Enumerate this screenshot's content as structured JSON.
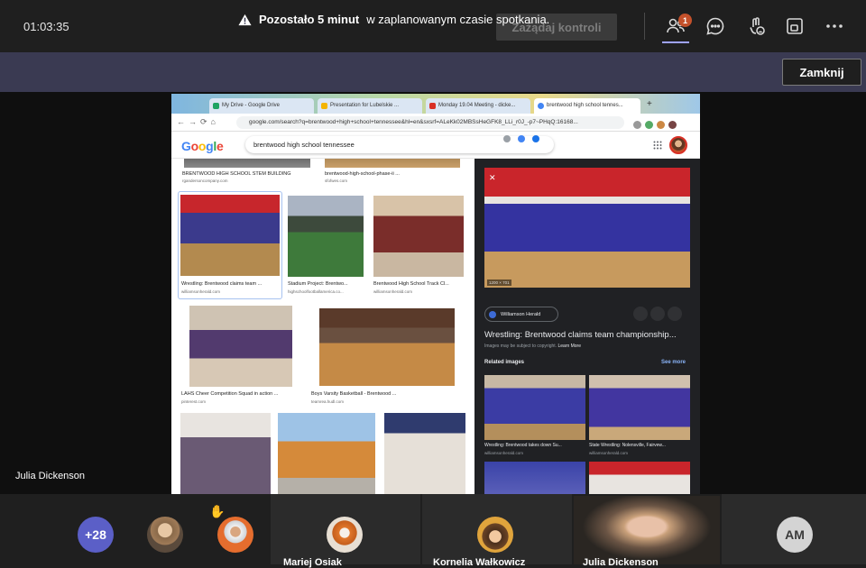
{
  "meeting": {
    "timer": "01:03:35",
    "request_control_label": "Zażądaj kontroli",
    "participants_badge": "1",
    "notice": {
      "strong": "Pozostało 5 minut",
      "rest": "w zaplanowanym czasie spotkania.",
      "close_label": "Zamknij"
    },
    "presenter_name": "Julia Dickenson",
    "participants": {
      "overflow_count": "+28",
      "names": [
        "Mariej Osiak",
        "Kornelia Wałkowicz",
        "Julia Dickenson"
      ],
      "initials": "AM"
    },
    "icons": [
      "people-icon",
      "chat-icon",
      "reactions-icon",
      "share-tray-icon",
      "more-icon"
    ]
  },
  "browser": {
    "tabs": [
      {
        "label": "My Drive - Google Drive",
        "color": "#1fa463"
      },
      {
        "label": "Presentation for Lubelskie ...",
        "color": "#f4b400"
      },
      {
        "label": "Monday 19.04 Meeting - dicke...",
        "color": "#d93025"
      },
      {
        "label": "brentwood high school tennes...",
        "color": "#4285f4"
      }
    ],
    "url": "google.com/search?q=brentwood+high+school+tennessee&hl=en&sxsrf=ALeKk02MBSsHeGFK8_LLi_r0J_-p7~PHqQ:16168...",
    "search_query": "brentwood high school tennessee"
  },
  "google": {
    "logo": "Google",
    "results": [
      {
        "title": "BRENTWOOD HIGH SCHOOL STEM BUILDING",
        "source": "rgandersoncompany.com"
      },
      {
        "title": "brentwood-high-school-phase-ii ...",
        "source": "sfofwes.com"
      },
      {
        "title": "Wrestling: Brentwood claims team ...",
        "source": "williamsonherald.com"
      },
      {
        "title": "Stadium Project: Brentwo...",
        "source": "highschoolfootballamerica.co..."
      },
      {
        "title": "Brentwood High School Track Cl...",
        "source": "williamsonherald.com"
      },
      {
        "title": "LAHS Cheer Competition Squad in action ...",
        "source": "pinterest.com"
      },
      {
        "title": "Boys Varsity Basketball - Brentwood ...",
        "source": "teamrea.hudl.com"
      }
    ],
    "preview": {
      "image_size": "1200 × 701",
      "source": "Williamson Herald",
      "title": "Wrestling: Brentwood claims team championship...",
      "copyright": "Images may be subject to copyright.",
      "learn_more": "Learn More",
      "related_label": "Related images",
      "see_more": "See more",
      "related": [
        {
          "title": "Wrestling: Brentwood takes down Su...",
          "source": "williamsonherald.com"
        },
        {
          "title": "State Wrestling: Nolensville, Fairvew...",
          "source": "williamsonherald.com"
        }
      ]
    }
  }
}
